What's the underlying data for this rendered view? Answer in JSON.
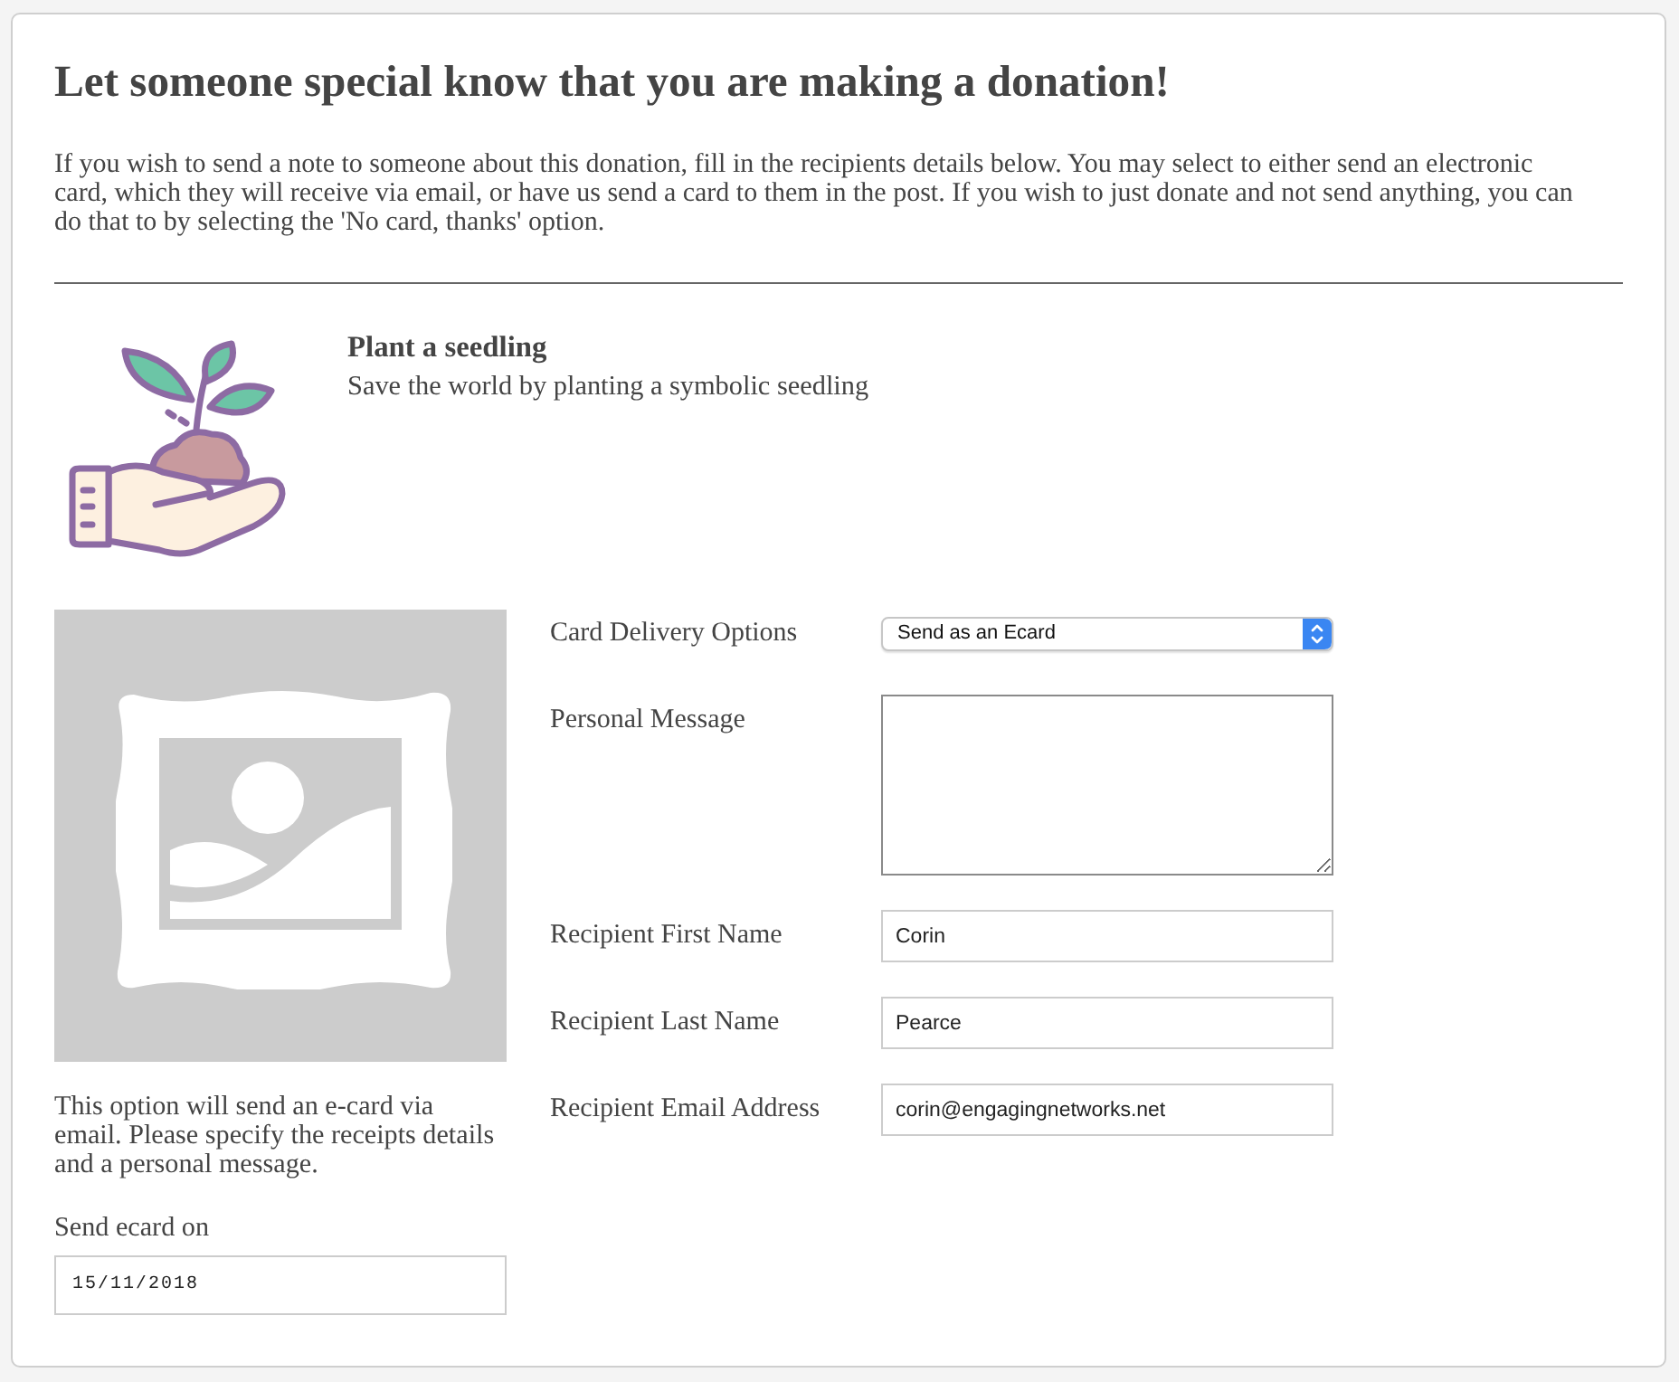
{
  "heading": "Let someone special know that you are making a donation!",
  "intro": "If you wish to send a note to someone about this donation, fill in the recipients details below. You may select to either send an electronic card, which they will receive via email, or have us send a card to them in the post. If you wish to just donate and not send anything, you can do that to by selecting the 'No card, thanks' option.",
  "gift": {
    "title": "Plant a seedling",
    "description": "Save the world by planting a symbolic seedling"
  },
  "ecard": {
    "note": "This option will send an e-card via email. Please specify the receipts details and a personal message.",
    "send_date": {
      "label": "Send ecard on",
      "value": "15/11/2018"
    }
  },
  "fields": [
    {
      "kind": "select",
      "label": "Card Delivery Options",
      "value": "Send as an Ecard"
    },
    {
      "kind": "textarea",
      "label": "Personal Message"
    },
    {
      "kind": "text",
      "label": "Recipient First Name",
      "value": "Corin"
    },
    {
      "kind": "text",
      "label": "Recipient Last Name",
      "value": "Pearce"
    },
    {
      "kind": "text",
      "label": "Recipient Email Address",
      "value": "corin@engagingnetworks.net"
    }
  ]
}
